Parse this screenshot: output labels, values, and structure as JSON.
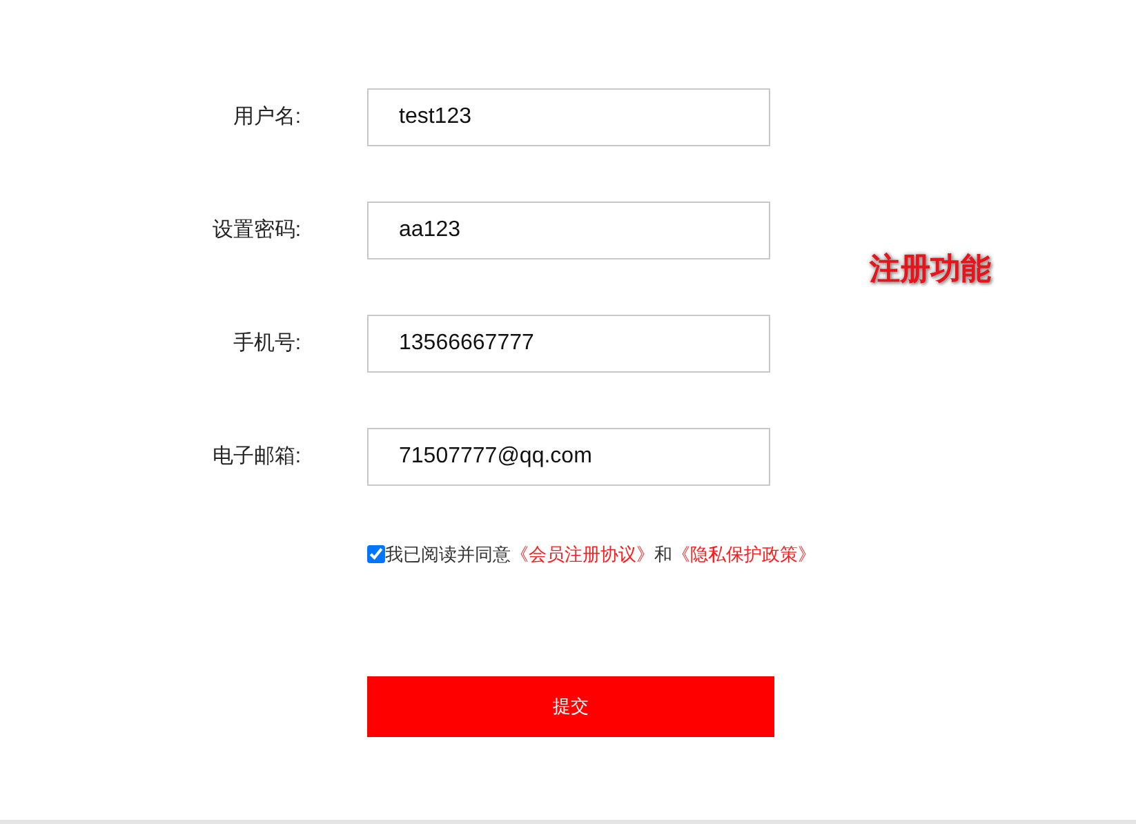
{
  "fields": [
    {
      "label": "用户名:",
      "value": "test123"
    },
    {
      "label": "设置密码:",
      "value": "aa123"
    },
    {
      "label": "手机号:",
      "value": "13566667777"
    },
    {
      "label": "电子邮箱:",
      "value": "71507777@qq.com"
    }
  ],
  "caption": "注册功能",
  "agreement": {
    "checked": true,
    "text": "我已阅读并同意",
    "link_1": "《会员注册协议》",
    "joiner": "和",
    "link_2": "《隐私保护政策》"
  },
  "submit": "提交"
}
